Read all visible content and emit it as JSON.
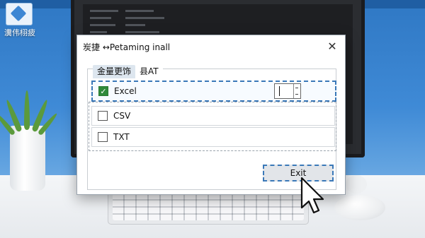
{
  "desktop": {
    "icon_label": "瀵伟栩疲"
  },
  "dialog": {
    "title": "炭捷 ↔Petaming inall",
    "close_glyph": "✕",
    "tabs": [
      {
        "label": "金量更饰",
        "active": true
      },
      {
        "label": "县AT",
        "active": false
      }
    ],
    "options": [
      {
        "label": "Excel",
        "checked": true
      },
      {
        "label": "CSV",
        "checked": false
      },
      {
        "label": "TXT",
        "checked": false
      }
    ],
    "exit_label": "Exit"
  },
  "colors": {
    "check_green": "#2f8a3a",
    "focus_blue": "#3a78b8",
    "desktop_blue": "#3f8ad6"
  },
  "icons": [
    "close-icon",
    "checkmark-icon",
    "mouse-pointer-icon",
    "spinner-arrows-icon",
    "desktop-app-icon"
  ]
}
